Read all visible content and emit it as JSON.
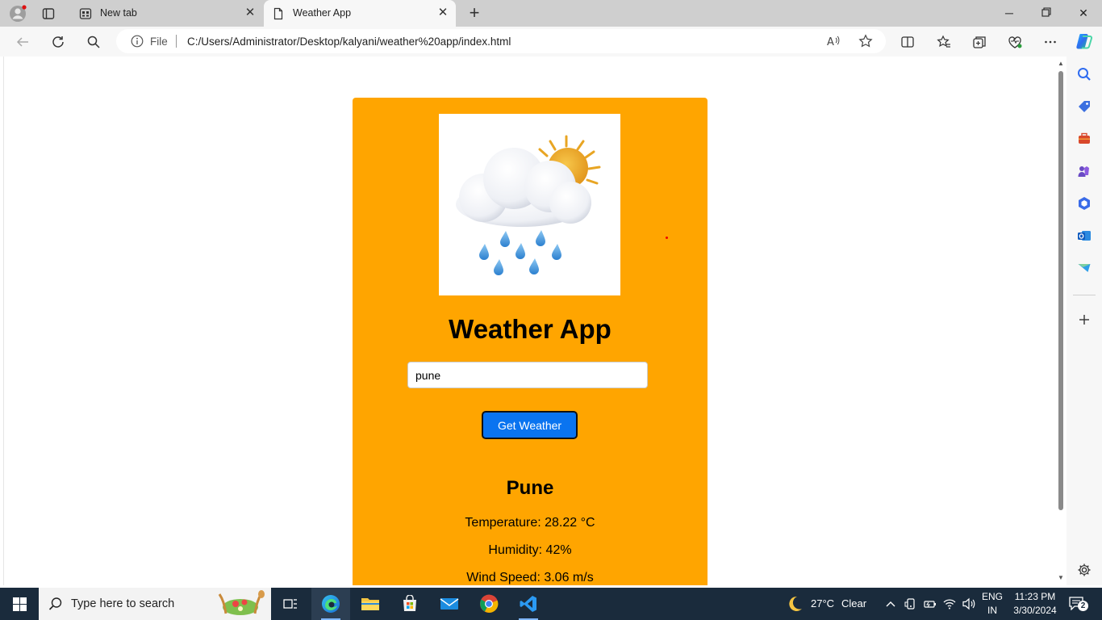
{
  "browser": {
    "tabs": [
      {
        "label": "New tab",
        "active": false
      },
      {
        "label": "Weather App",
        "active": true
      }
    ],
    "address": {
      "scheme_label": "File",
      "url": "C:/Users/Administrator/Desktop/kalyani/weather%20app/index.html"
    }
  },
  "page": {
    "title": "Weather App",
    "search": {
      "value": "pune"
    },
    "button_label": "Get Weather",
    "result": {
      "city": "Pune",
      "temperature": "Temperature: 28.22 °C",
      "humidity": "Humidity: 42%",
      "wind": "Wind Speed: 3.06 m/s"
    },
    "colors": {
      "card": "#ffa500",
      "button": "#0a74f0"
    }
  },
  "taskbar": {
    "search_placeholder": "Type here to search",
    "weather": {
      "temp": "27°C",
      "condition": "Clear"
    },
    "language": {
      "lang": "ENG",
      "region": "IN"
    },
    "clock": {
      "time": "11:23 PM",
      "date": "3/30/2024"
    },
    "notification_count": "2"
  }
}
